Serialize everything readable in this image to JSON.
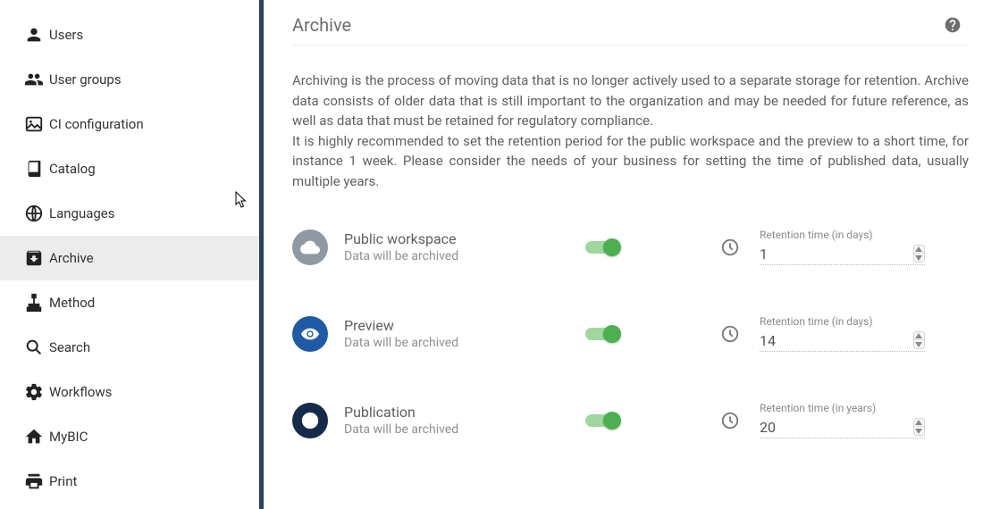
{
  "sidebar": {
    "items": [
      {
        "label": "Users",
        "icon": "person-icon"
      },
      {
        "label": "User groups",
        "icon": "people-icon"
      },
      {
        "label": "CI configuration",
        "icon": "image-icon"
      },
      {
        "label": "Catalog",
        "icon": "book-icon"
      },
      {
        "label": "Languages",
        "icon": "globe-icon"
      },
      {
        "label": "Archive",
        "icon": "archive-icon"
      },
      {
        "label": "Method",
        "icon": "sitemap-icon"
      },
      {
        "label": "Search",
        "icon": "search-icon"
      },
      {
        "label": "Workflows",
        "icon": "gear-icon"
      },
      {
        "label": "MyBIC",
        "icon": "home-icon"
      },
      {
        "label": "Print",
        "icon": "print-icon"
      }
    ],
    "active_index": 5
  },
  "header": {
    "title": "Archive"
  },
  "intro": {
    "p1": "Archiving is the process of moving data that is no longer actively used to a separate storage for retention. Archive data consists of older data that is still important to the organization and may be needed for future reference, as well as data that must be retained for regulatory compliance.",
    "p2": "It is highly recommended to set the retention period for the public workspace and the preview to a short time, for instance 1 week. Please consider the needs of your business for setting the time of published data, usually multiple years."
  },
  "field_labels": {
    "days": "Retention time (in days)",
    "years": "Retention time (in years)"
  },
  "rows": [
    {
      "title": "Public workspace",
      "sub": "Data will be archived",
      "icon": "cloud-icon",
      "icon_bg": "#8e99a4",
      "enabled": true,
      "unit": "days",
      "value": "1"
    },
    {
      "title": "Preview",
      "sub": "Data will be archived",
      "icon": "eye-icon",
      "icon_bg": "#1e5aa6",
      "enabled": true,
      "unit": "days",
      "value": "14"
    },
    {
      "title": "Publication",
      "sub": "Data will be archived",
      "icon": "public-icon",
      "icon_bg": "#152b4a",
      "enabled": true,
      "unit": "years",
      "value": "20"
    }
  ]
}
